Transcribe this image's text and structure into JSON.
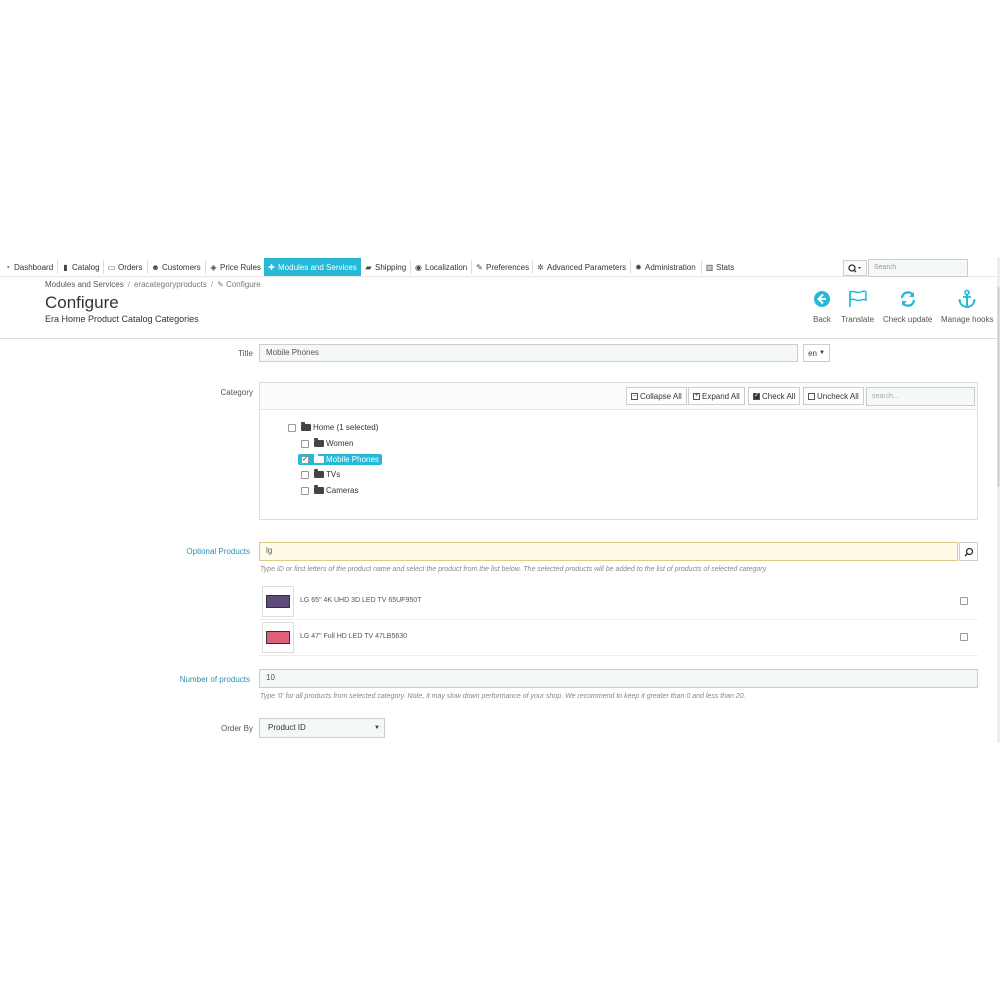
{
  "nav": {
    "items": [
      {
        "label": "Dashboard",
        "icon": "dashboard-icon"
      },
      {
        "label": "Catalog",
        "icon": "book-icon"
      },
      {
        "label": "Orders",
        "icon": "credit-card-icon"
      },
      {
        "label": "Customers",
        "icon": "users-icon"
      },
      {
        "label": "Price Rules",
        "icon": "tags-icon"
      },
      {
        "label": "Modules and Services",
        "icon": "puzzle-icon",
        "active": true
      },
      {
        "label": "Shipping",
        "icon": "truck-icon"
      },
      {
        "label": "Localization",
        "icon": "globe-icon"
      },
      {
        "label": "Preferences",
        "icon": "wrench-icon"
      },
      {
        "label": "Advanced Parameters",
        "icon": "cogs-icon"
      },
      {
        "label": "Administration",
        "icon": "gear-icon"
      },
      {
        "label": "Stats",
        "icon": "bar-chart-icon"
      }
    ],
    "search_placeholder": "Search"
  },
  "header": {
    "breadcrumb": [
      "Modules and Services",
      "eracategoryproducts",
      "Configure"
    ],
    "breadcrumb_sep": "/",
    "title": "Configure",
    "subtitle": "Era Home Product Catalog Categories",
    "toolbar": [
      {
        "label": "Back",
        "icon": "back-arrow-icon"
      },
      {
        "label": "Translate",
        "icon": "flag-icon"
      },
      {
        "label": "Check update",
        "icon": "refresh-icon"
      },
      {
        "label": "Manage hooks",
        "icon": "anchor-icon"
      }
    ]
  },
  "form": {
    "title_label": "Title",
    "title_value": "Mobile Phones",
    "lang": "en",
    "category_label": "Category",
    "tree_buttons": {
      "collapse": "Collapse All",
      "expand": "Expand All",
      "check": "Check All",
      "uncheck": "Uncheck All"
    },
    "tree_search_placeholder": "search...",
    "tree": [
      {
        "label": "Home (1 selected)",
        "checked": false,
        "selected": false
      },
      {
        "label": "Women",
        "checked": false,
        "selected": false
      },
      {
        "label": "Mobile Phones",
        "checked": true,
        "selected": true
      },
      {
        "label": "TVs",
        "checked": false,
        "selected": false
      },
      {
        "label": "Cameras",
        "checked": false,
        "selected": false
      }
    ],
    "optional_label": "Optional Products",
    "optional_value": "lg",
    "optional_help": "Type ID or first letters of the product name and select the product from the list below. The selected products will be added to the list of products of selected category.",
    "products": [
      {
        "name": "LG 65\" 4K UHD 3D LED TV 65UF950T",
        "screen": "#5b4a7a"
      },
      {
        "name": "LG 47\" Full HD LED TV 47LB5630",
        "screen": "#e0607a"
      }
    ],
    "number_label": "Number of products",
    "number_value": "10",
    "number_help": "Type '0' for all products from selected category. Note, it may slow down performance of your shop. We recommend to keep it greater than 0 and less than 20.",
    "order_label": "Order By",
    "order_value": "Product ID"
  },
  "colors": {
    "accent": "#25b9d7",
    "required_label": "#2a90b0"
  }
}
